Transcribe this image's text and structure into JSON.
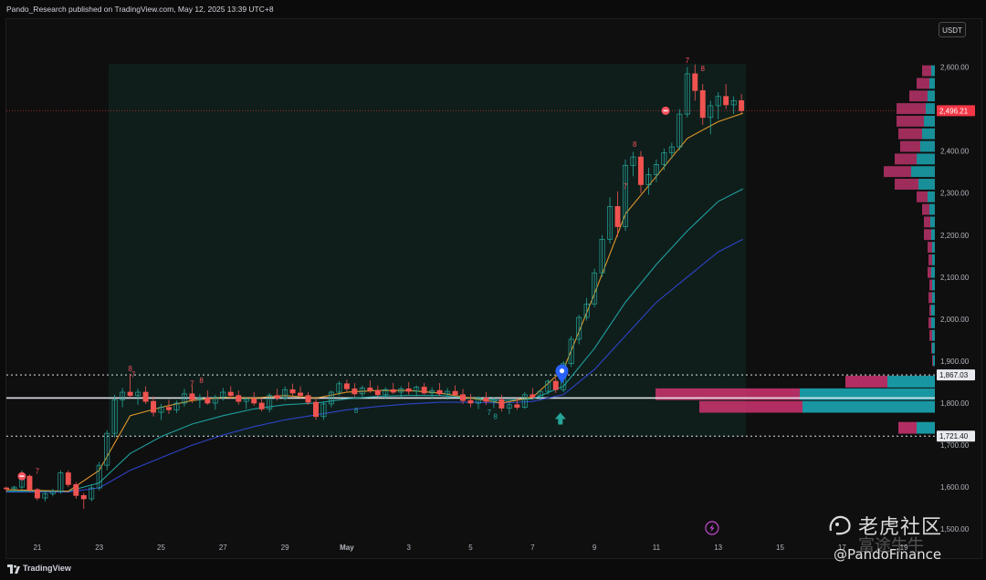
{
  "header": {
    "published_text": "Pando_Research published on TradingView.com, May 12, 2025 13:39 UTC+8"
  },
  "currency": "USDT",
  "footer": {
    "logo_text": "TradingView"
  },
  "watermark": {
    "cn_text": "老虎社区",
    "handle": "@PandoFinance",
    "faded_text": "富途牛牛"
  },
  "chart_data": {
    "type": "candlestick",
    "symbol_quote": "USDT",
    "y_ticks": [
      1500,
      1600,
      1700,
      1800,
      1900,
      2000,
      2100,
      2200,
      2300,
      2400,
      2500,
      2600
    ],
    "y_tick_labels": [
      "1,500.00",
      "1,600.00",
      "1,700.00",
      "1,800.00",
      "1,900.00",
      "2,000.00",
      "2,100.00",
      "2,200.00",
      "2,300.00",
      "2,400.00",
      "2,500.00",
      "2,600.00"
    ],
    "ylim": [
      1470,
      2625
    ],
    "x_tick_labels": [
      "21",
      "23",
      "25",
      "27",
      "29",
      "May",
      "3",
      "5",
      "7",
      "9",
      "11",
      "13",
      "15",
      "17",
      "19"
    ],
    "x_range_days": [
      20,
      50
    ],
    "last_price": {
      "value": 2496.21,
      "label": "2,496.21",
      "color": "#f23645"
    },
    "levels": [
      {
        "value": 1867.03,
        "label": "1,867.03",
        "style": "dotted"
      },
      {
        "value": 1812.0,
        "label": "",
        "style": "solid"
      },
      {
        "value": 1721.4,
        "label": "1,721.40",
        "style": "dotted"
      }
    ],
    "candles": [
      [
        20.0,
        1598,
        1601,
        1588,
        1596
      ],
      [
        20.25,
        1596,
        1603,
        1590,
        1600
      ],
      [
        20.5,
        1600,
        1640,
        1594,
        1626
      ],
      [
        20.75,
        1626,
        1630,
        1588,
        1594
      ],
      [
        21.0,
        1594,
        1598,
        1568,
        1574
      ],
      [
        21.25,
        1574,
        1590,
        1566,
        1584
      ],
      [
        21.5,
        1584,
        1596,
        1578,
        1590
      ],
      [
        21.75,
        1590,
        1640,
        1584,
        1634
      ],
      [
        22.0,
        1634,
        1640,
        1600,
        1606
      ],
      [
        22.25,
        1606,
        1612,
        1572,
        1580
      ],
      [
        22.5,
        1580,
        1586,
        1548,
        1572
      ],
      [
        22.75,
        1572,
        1606,
        1566,
        1598
      ],
      [
        23.0,
        1598,
        1660,
        1592,
        1652
      ],
      [
        23.25,
        1652,
        1736,
        1640,
        1728
      ],
      [
        23.5,
        1728,
        1820,
        1718,
        1808
      ],
      [
        23.75,
        1808,
        1836,
        1790,
        1826
      ],
      [
        24.0,
        1826,
        1870,
        1812,
        1818
      ],
      [
        24.25,
        1818,
        1834,
        1796,
        1826
      ],
      [
        24.5,
        1826,
        1840,
        1798,
        1804
      ],
      [
        24.75,
        1804,
        1816,
        1768,
        1778
      ],
      [
        25.0,
        1778,
        1798,
        1760,
        1790
      ],
      [
        25.25,
        1790,
        1808,
        1774,
        1784
      ],
      [
        25.5,
        1784,
        1806,
        1776,
        1800
      ],
      [
        25.75,
        1800,
        1834,
        1792,
        1822
      ],
      [
        26.0,
        1822,
        1842,
        1800,
        1808
      ],
      [
        26.25,
        1808,
        1822,
        1788,
        1812
      ],
      [
        26.5,
        1812,
        1830,
        1796,
        1800
      ],
      [
        26.75,
        1800,
        1820,
        1784,
        1814
      ],
      [
        27.0,
        1814,
        1836,
        1806,
        1826
      ],
      [
        27.25,
        1826,
        1840,
        1810,
        1818
      ],
      [
        27.5,
        1818,
        1830,
        1796,
        1804
      ],
      [
        27.75,
        1804,
        1814,
        1786,
        1810
      ],
      [
        28.0,
        1810,
        1826,
        1794,
        1800
      ],
      [
        28.25,
        1800,
        1812,
        1780,
        1786
      ],
      [
        28.5,
        1786,
        1824,
        1778,
        1818
      ],
      [
        28.75,
        1818,
        1834,
        1806,
        1812
      ],
      [
        29.0,
        1812,
        1840,
        1806,
        1832
      ],
      [
        29.25,
        1832,
        1846,
        1818,
        1824
      ],
      [
        29.5,
        1824,
        1840,
        1812,
        1818
      ],
      [
        29.75,
        1818,
        1826,
        1796,
        1802
      ],
      [
        30.0,
        1802,
        1810,
        1760,
        1768
      ],
      [
        30.25,
        1768,
        1804,
        1760,
        1798
      ],
      [
        30.5,
        1798,
        1830,
        1790,
        1826
      ],
      [
        30.75,
        1826,
        1852,
        1818,
        1846
      ],
      [
        31.0,
        1846,
        1856,
        1826,
        1834
      ],
      [
        31.25,
        1834,
        1848,
        1816,
        1822
      ],
      [
        31.5,
        1822,
        1842,
        1814,
        1836
      ],
      [
        31.75,
        1836,
        1854,
        1824,
        1830
      ],
      [
        32.0,
        1830,
        1842,
        1814,
        1820
      ],
      [
        32.25,
        1820,
        1838,
        1810,
        1832
      ],
      [
        32.5,
        1832,
        1848,
        1822,
        1826
      ],
      [
        32.75,
        1826,
        1840,
        1812,
        1834
      ],
      [
        33.0,
        1834,
        1850,
        1820,
        1828
      ],
      [
        33.25,
        1828,
        1842,
        1816,
        1838
      ],
      [
        33.5,
        1838,
        1848,
        1820,
        1824
      ],
      [
        33.75,
        1824,
        1838,
        1810,
        1830
      ],
      [
        34.0,
        1830,
        1848,
        1818,
        1822
      ],
      [
        34.25,
        1822,
        1836,
        1808,
        1828
      ],
      [
        34.5,
        1828,
        1842,
        1816,
        1820
      ],
      [
        34.75,
        1820,
        1834,
        1798,
        1806
      ],
      [
        35.0,
        1806,
        1822,
        1790,
        1800
      ],
      [
        35.25,
        1800,
        1816,
        1786,
        1812
      ],
      [
        35.5,
        1812,
        1826,
        1796,
        1804
      ],
      [
        35.75,
        1804,
        1814,
        1788,
        1808
      ],
      [
        36.0,
        1808,
        1820,
        1780,
        1788
      ],
      [
        36.25,
        1788,
        1802,
        1774,
        1796
      ],
      [
        36.5,
        1796,
        1812,
        1784,
        1790
      ],
      [
        36.75,
        1790,
        1826,
        1786,
        1820
      ],
      [
        37.0,
        1820,
        1836,
        1808,
        1814
      ],
      [
        37.25,
        1814,
        1830,
        1806,
        1828
      ],
      [
        37.5,
        1828,
        1856,
        1820,
        1852
      ],
      [
        37.75,
        1852,
        1860,
        1824,
        1832
      ],
      [
        38.0,
        1832,
        1900,
        1826,
        1894
      ],
      [
        38.25,
        1894,
        1960,
        1886,
        1952
      ],
      [
        38.5,
        1952,
        2010,
        1940,
        2004
      ],
      [
        38.75,
        2004,
        2050,
        1996,
        2036
      ],
      [
        39.0,
        2036,
        2120,
        2028,
        2110
      ],
      [
        39.25,
        2110,
        2200,
        2100,
        2190
      ],
      [
        39.5,
        2190,
        2290,
        2180,
        2268
      ],
      [
        39.75,
        2268,
        2304,
        2196,
        2220
      ],
      [
        40.0,
        2220,
        2380,
        2210,
        2366
      ],
      [
        40.25,
        2366,
        2398,
        2340,
        2386
      ],
      [
        40.5,
        2386,
        2400,
        2300,
        2320
      ],
      [
        40.75,
        2320,
        2360,
        2296,
        2344
      ],
      [
        41.0,
        2344,
        2380,
        2326,
        2368
      ],
      [
        41.25,
        2368,
        2406,
        2354,
        2396
      ],
      [
        41.5,
        2396,
        2420,
        2382,
        2410
      ],
      [
        41.75,
        2410,
        2500,
        2402,
        2488
      ],
      [
        42.0,
        2488,
        2600,
        2480,
        2584
      ],
      [
        42.25,
        2584,
        2606,
        2520,
        2544
      ],
      [
        42.5,
        2544,
        2560,
        2462,
        2480
      ],
      [
        42.75,
        2480,
        2520,
        2440,
        2508
      ],
      [
        43.0,
        2508,
        2540,
        2476,
        2530
      ],
      [
        43.25,
        2530,
        2560,
        2500,
        2510
      ],
      [
        43.5,
        2510,
        2530,
        2488,
        2520
      ],
      [
        43.75,
        2520,
        2536,
        2490,
        2496
      ]
    ],
    "ema_fast": [
      [
        20,
        1594
      ],
      [
        21,
        1592
      ],
      [
        22,
        1590
      ],
      [
        23,
        1640
      ],
      [
        24,
        1770
      ],
      [
        25,
        1790
      ],
      [
        26,
        1806
      ],
      [
        27,
        1814
      ],
      [
        28,
        1812
      ],
      [
        29,
        1818
      ],
      [
        30,
        1812
      ],
      [
        31,
        1826
      ],
      [
        32,
        1830
      ],
      [
        33,
        1830
      ],
      [
        34,
        1824
      ],
      [
        35,
        1812
      ],
      [
        36,
        1800
      ],
      [
        37,
        1814
      ],
      [
        38,
        1880
      ],
      [
        39,
        2060
      ],
      [
        40,
        2250
      ],
      [
        41,
        2340
      ],
      [
        42,
        2430
      ],
      [
        43,
        2470
      ],
      [
        43.8,
        2490
      ]
    ],
    "ema_mid": [
      [
        20,
        1590
      ],
      [
        21,
        1590
      ],
      [
        22,
        1590
      ],
      [
        23,
        1610
      ],
      [
        24,
        1680
      ],
      [
        25,
        1720
      ],
      [
        26,
        1750
      ],
      [
        27,
        1770
      ],
      [
        28,
        1786
      ],
      [
        29,
        1796
      ],
      [
        30,
        1800
      ],
      [
        31,
        1810
      ],
      [
        32,
        1816
      ],
      [
        33,
        1818
      ],
      [
        34,
        1818
      ],
      [
        35,
        1812
      ],
      [
        36,
        1806
      ],
      [
        37,
        1810
      ],
      [
        38,
        1840
      ],
      [
        39,
        1930
      ],
      [
        40,
        2040
      ],
      [
        41,
        2130
      ],
      [
        42,
        2210
      ],
      [
        43,
        2280
      ],
      [
        43.8,
        2310
      ]
    ],
    "ema_slow": [
      [
        20,
        1588
      ],
      [
        21,
        1588
      ],
      [
        22,
        1588
      ],
      [
        23,
        1598
      ],
      [
        24,
        1640
      ],
      [
        25,
        1670
      ],
      [
        26,
        1700
      ],
      [
        27,
        1724
      ],
      [
        28,
        1744
      ],
      [
        29,
        1760
      ],
      [
        30,
        1772
      ],
      [
        31,
        1784
      ],
      [
        32,
        1792
      ],
      [
        33,
        1798
      ],
      [
        34,
        1802
      ],
      [
        35,
        1802
      ],
      [
        36,
        1800
      ],
      [
        37,
        1804
      ],
      [
        38,
        1820
      ],
      [
        39,
        1880
      ],
      [
        40,
        1960
      ],
      [
        41,
        2040
      ],
      [
        42,
        2100
      ],
      [
        43,
        2160
      ],
      [
        43.8,
        2190
      ]
    ],
    "volume_profile": [
      {
        "price": 2590,
        "up": 4,
        "down": 10
      },
      {
        "price": 2560,
        "up": 6,
        "down": 14
      },
      {
        "price": 2530,
        "up": 8,
        "down": 20
      },
      {
        "price": 2500,
        "up": 10,
        "down": 32
      },
      {
        "price": 2470,
        "up": 12,
        "down": 30
      },
      {
        "price": 2440,
        "up": 14,
        "down": 26
      },
      {
        "price": 2410,
        "up": 16,
        "down": 22
      },
      {
        "price": 2380,
        "up": 20,
        "down": 24
      },
      {
        "price": 2350,
        "up": 26,
        "down": 30
      },
      {
        "price": 2320,
        "up": 18,
        "down": 26
      },
      {
        "price": 2290,
        "up": 8,
        "down": 12
      },
      {
        "price": 2260,
        "up": 6,
        "down": 8
      },
      {
        "price": 2230,
        "up": 5,
        "down": 7
      },
      {
        "price": 2200,
        "up": 4,
        "down": 8
      },
      {
        "price": 2170,
        "up": 3,
        "down": 5
      },
      {
        "price": 2140,
        "up": 3,
        "down": 4
      },
      {
        "price": 2110,
        "up": 4,
        "down": 4
      },
      {
        "price": 2080,
        "up": 3,
        "down": 3
      },
      {
        "price": 2050,
        "up": 3,
        "down": 4
      },
      {
        "price": 2020,
        "up": 4,
        "down": 2
      },
      {
        "price": 1990,
        "up": 4,
        "down": 3
      },
      {
        "price": 1960,
        "up": 3,
        "down": 3
      },
      {
        "price": 1930,
        "up": 3,
        "down": 1
      },
      {
        "price": 1900,
        "up": 2,
        "down": 1
      }
    ],
    "range_volume_profile": [
      {
        "price": 1850,
        "up": 52,
        "down": 46
      },
      {
        "price": 1820,
        "up": 148,
        "down": 158
      },
      {
        "price": 1790,
        "up": 145,
        "down": 113
      },
      {
        "price": 1740,
        "up": 20,
        "down": 20
      }
    ],
    "markers": [
      {
        "t": 21.0,
        "price": 1632,
        "text": "7",
        "color": "#f7525f"
      },
      {
        "t": 24.0,
        "price": 1876,
        "text": "8",
        "color": "#f7525f"
      },
      {
        "t": 24.1,
        "price": 1862,
        "text": "7",
        "color": "#f7525f"
      },
      {
        "t": 26.3,
        "price": 1848,
        "text": "8",
        "color": "#f7525f"
      },
      {
        "t": 26.0,
        "price": 1840,
        "text": "7",
        "color": "#f7525f"
      },
      {
        "t": 40.3,
        "price": 2410,
        "text": "8",
        "color": "#f7525f"
      },
      {
        "t": 40.0,
        "price": 2310,
        "text": "7",
        "color": "#f7525f"
      },
      {
        "t": 42.0,
        "price": 2610,
        "text": "7",
        "color": "#f7525f"
      },
      {
        "t": 42.5,
        "price": 2590,
        "text": "8",
        "color": "#f7525f"
      },
      {
        "t": 35.6,
        "price": 1772,
        "text": "7",
        "color": "#26a69a"
      },
      {
        "t": 35.8,
        "price": 1762,
        "text": "8",
        "color": "#26a69a"
      },
      {
        "t": 31.3,
        "price": 1776,
        "text": "8",
        "color": "#26a69a"
      }
    ]
  }
}
